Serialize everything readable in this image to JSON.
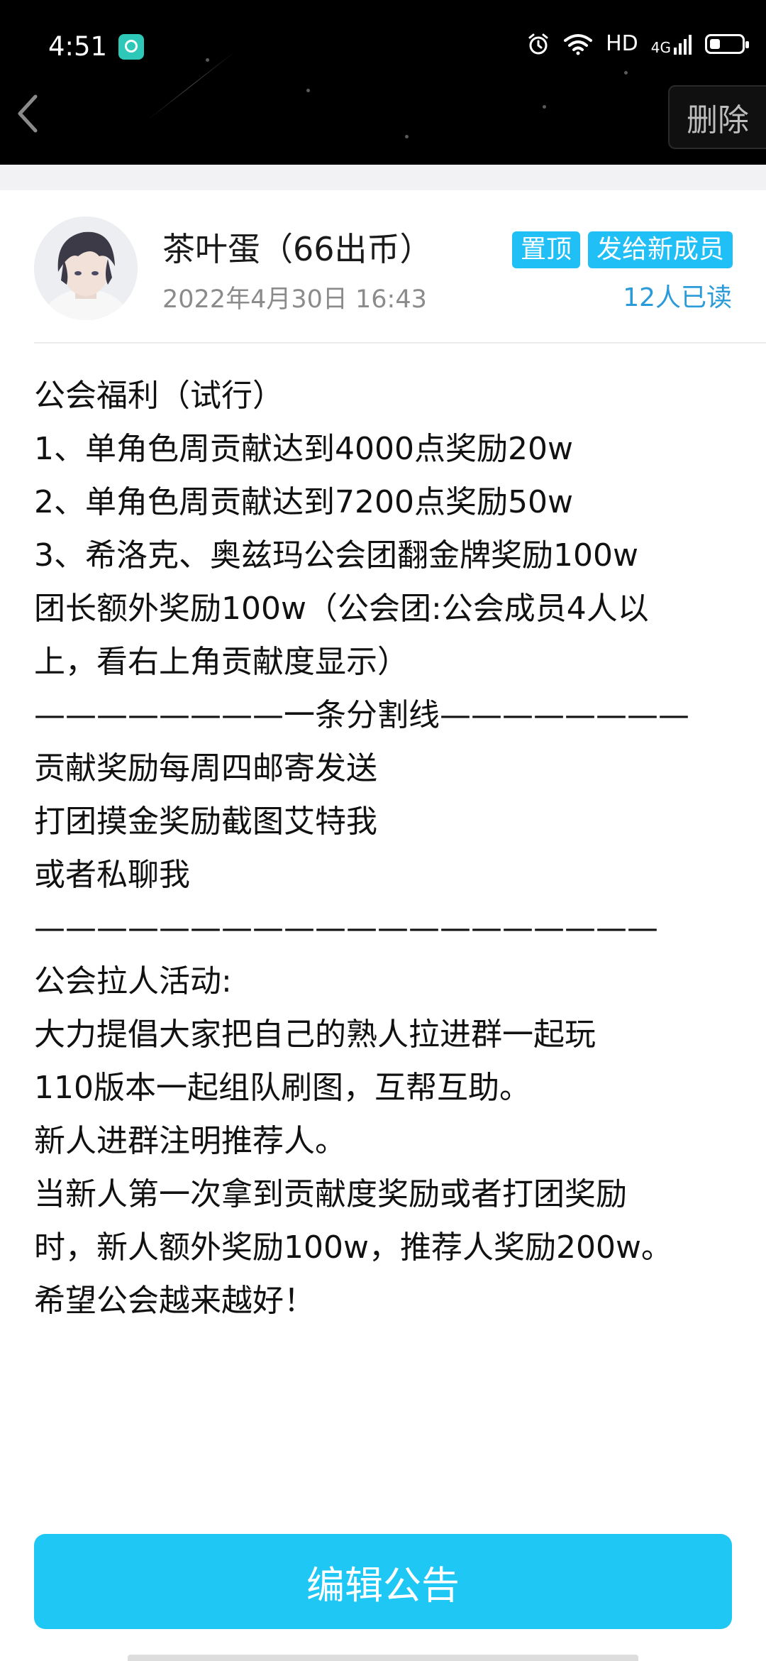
{
  "status_bar": {
    "time": "4:51",
    "hd_label": "HD",
    "network_label": "4G"
  },
  "header": {
    "back_icon": "chevron-left-icon",
    "delete_label": "删除"
  },
  "notice": {
    "author": "茶叶蛋（66出币）",
    "date": "2022年4月30日 16:43",
    "tags": {
      "pin": "置顶",
      "send_new": "发给新成员"
    },
    "read_count": "12人已读",
    "lines": [
      "公会福利（试行）",
      "1、单角色周贡献达到4000点奖励20w",
      "2、单角色周贡献达到7200点奖励50w",
      "3、希洛克、奥兹玛公会团翻金牌奖励100w",
      "团长额外奖励100w（公会团:公会成员4人以",
      "上，看右上角贡献度显示）",
      "————————一条分割线————————",
      "贡献奖励每周四邮寄发送",
      "打团摸金奖励截图艾特我",
      "或者私聊我",
      "————————————————————",
      "公会拉人活动:",
      "大力提倡大家把自己的熟人拉进群一起玩",
      "110版本一起组队刷图，互帮互助。",
      "新人进群注明推荐人。",
      "当新人第一次拿到贡献度奖励或者打团奖励",
      "时，新人额外奖励100w，推荐人奖励200w。",
      "希望公会越来越好！"
    ]
  },
  "footer": {
    "edit_label": "编辑公告"
  },
  "colors": {
    "accent": "#1fc7f5",
    "tag_bg": "#20bff5",
    "read_count": "#2a9ad8",
    "header_bg": "#000000"
  }
}
